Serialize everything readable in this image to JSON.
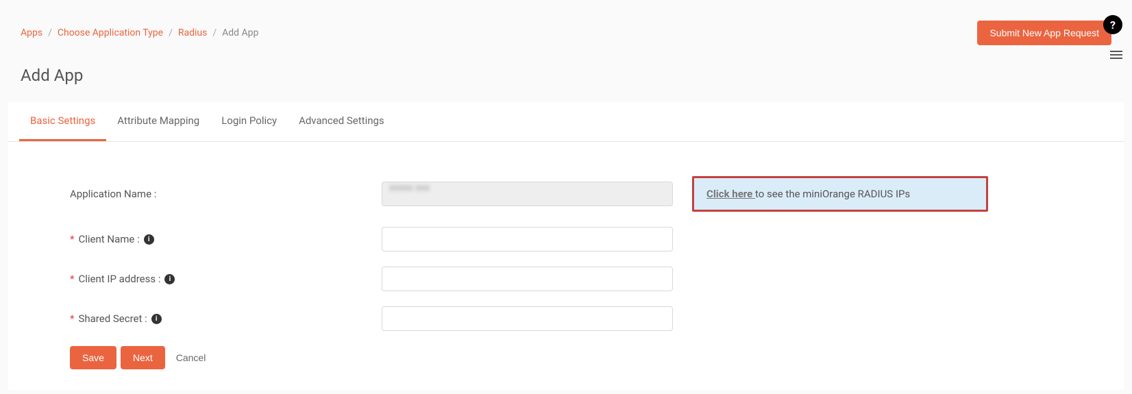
{
  "breadcrumb": {
    "items": [
      {
        "label": "Apps"
      },
      {
        "label": "Choose Application Type"
      },
      {
        "label": "Radius"
      }
    ],
    "current": "Add App"
  },
  "header": {
    "submit_label": "Submit New App Request",
    "page_title": "Add App"
  },
  "tabs": [
    {
      "label": "Basic Settings",
      "active": true
    },
    {
      "label": "Attribute Mapping",
      "active": false
    },
    {
      "label": "Login Policy",
      "active": false
    },
    {
      "label": "Advanced Settings",
      "active": false
    }
  ],
  "form": {
    "app_name_label": "Application Name :",
    "app_name_value": "xxxxx  xxx",
    "client_name_label": "Client Name :",
    "client_name_value": "",
    "client_ip_label": "Client IP address :",
    "client_ip_value": "",
    "shared_secret_label": "Shared Secret :",
    "shared_secret_value": ""
  },
  "info_box": {
    "link_text": "Click here ",
    "rest_text": "to see the miniOrange RADIUS IPs"
  },
  "buttons": {
    "save": "Save",
    "next": "Next",
    "cancel": "Cancel"
  },
  "icons": {
    "help": "?",
    "info": "i"
  }
}
